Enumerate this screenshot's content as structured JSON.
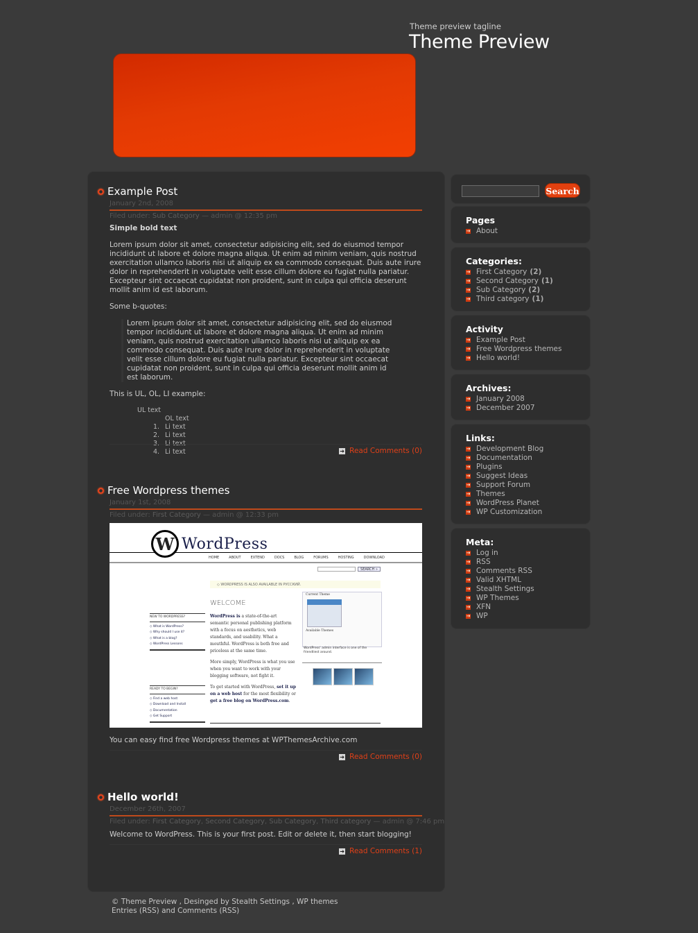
{
  "header": {
    "tagline": "Theme preview tagline",
    "title": "Theme Preview",
    "banner_color": "#e33a03"
  },
  "posts": [
    {
      "title": "Example Post",
      "date": "January 2nd, 2008",
      "filed_label": "Filed under: ",
      "categories": [
        "Sub Category"
      ],
      "meta_suffix": " — admin @ 12:35 pm",
      "bold_text": "Simple bold text",
      "paragraph": "Lorem ipsum dolor sit amet, consectetur adipisicing elit, sed do eiusmod tempor incididunt ut labore et dolore magna aliqua. Ut enim ad minim veniam, quis nostrud exercitation ullamco laboris nisi ut aliquip ex ea commodo consequat. Duis aute irure dolor in reprehenderit in voluptate velit esse cillum dolore eu fugiat nulla pariatur. Excepteur sint occaecat cupidatat non proident, sunt in culpa qui officia deserunt mollit anim id est laborum.",
      "quotes_label": "Some b-quotes:",
      "blockquote": "Lorem ipsum dolor sit amet, consectetur adipisicing elit, sed do eiusmod tempor incididunt ut labore et dolore magna aliqua. Ut enim ad minim veniam, quis nostrud exercitation ullamco laboris nisi ut aliquip ex ea commodo consequat. Duis aute irure dolor in reprehenderit in voluptate velit esse cillum dolore eu fugiat nulla pariatur. Excepteur sint occaecat cupidatat non proident, sunt in culpa qui officia deserunt mollit anim id est laborum.",
      "list_label": "This is UL, OL, LI example:",
      "ul_text": "UL text",
      "ol_text": "OL text",
      "li_items": [
        {
          "num": "1.",
          "text": "Li text"
        },
        {
          "num": "2.",
          "text": "Li text"
        },
        {
          "num": "3.",
          "text": "Li text"
        },
        {
          "num": "4.",
          "text": "Li text"
        }
      ],
      "comments_link": "Read Comments (0)"
    },
    {
      "title": "Free Wordpress themes",
      "date": "January 1st, 2008",
      "filed_label": "Filed under: ",
      "categories": [
        "First Category"
      ],
      "meta_suffix": " — admin @ 12:33 pm",
      "text_before": "You can easy find free ",
      "link_text": "Wordpress themes",
      "text_after": " at WPThemesArchive.com",
      "comments_link": "Read Comments (0)",
      "image": {
        "logo_letter": "W",
        "logo_word": "WordPress",
        "nav": [
          "HOME",
          "ABOUT",
          "EXTEND",
          "DOCS",
          "BLOG",
          "FORUMS",
          "HOSTING",
          "DOWNLOAD"
        ],
        "search_button": "SEARCH »",
        "notice": "◇ WORDPRESS IS ALSO AVAILABLE IN РУССКИЙ.",
        "welcome": "WELCOME",
        "para1_bold": "WordPress is",
        "para1": " a state-of-the-art semantic personal publishing platform with a focus on aesthetics, web standards, and usability. What a mouthful. WordPress is both free and priceless at the same time.",
        "para2": "More simply, WordPress is what you use when you want to work with your blogging software, not fight it.",
        "para3_pre": "To get started with WordPress, ",
        "para3_link1": "set it up on a web host",
        "para3_mid": " for the most flexibility or ",
        "para3_link2": "get a free blog on WordPress.com",
        "para3_end": ".",
        "side1_title": "NEW TO WORDPRESS?",
        "side1_items": [
          "◇ What is WordPress?",
          "◇ Why should I use it?",
          "◇ What is a blog?",
          "◇ WordPress Lessons"
        ],
        "side2_title": "READY TO BEGIN?",
        "side2_items": [
          "◇ Find a web host",
          "◇ Download and Install",
          "◇ Documentation",
          "◇ Get Support"
        ],
        "theme_box_title": "Current Theme",
        "theme_box_sub": "Available Themes",
        "caption": "WordPress' admin interface is one of the friendliest around."
      }
    },
    {
      "title": "Hello world!",
      "date": "December 26th, 2007",
      "filed_label": "Filed under: ",
      "categories": [
        "First Category",
        "Second Category",
        "Sub Category",
        "Third category"
      ],
      "meta_suffix": " — admin @ 7:46 pm",
      "body": "Welcome to WordPress. This is your first post. Edit or delete it, then start blogging!",
      "comments_link": "Read Comments (1)"
    }
  ],
  "sidebar": {
    "search": {
      "placeholder": "",
      "button": "Search"
    },
    "pages": {
      "title": "Pages",
      "items": [
        "About"
      ]
    },
    "categories": {
      "title": "Categories:",
      "items": [
        {
          "label": "First Category",
          "count": "(2)"
        },
        {
          "label": "Second Category",
          "count": "(1)"
        },
        {
          "label": "Sub Category",
          "count": "(2)"
        },
        {
          "label": "Third category",
          "count": "(1)"
        }
      ]
    },
    "activity": {
      "title": "Activity",
      "items": [
        "Example Post",
        "Free Wordpress themes",
        "Hello world!"
      ]
    },
    "archives": {
      "title": "Archives:",
      "items": [
        "January 2008",
        "December 2007"
      ]
    },
    "links": {
      "title": "Links:",
      "items": [
        "Development Blog",
        "Documentation",
        "Plugins",
        "Suggest Ideas",
        "Support Forum",
        "Themes",
        "WordPress Planet",
        "WP Customization"
      ]
    },
    "meta": {
      "title": "Meta:",
      "items": [
        "Log in",
        "RSS",
        "Comments RSS",
        "Valid XHTML",
        "Stealth Settings",
        "WP Themes",
        "XFN",
        "WP"
      ]
    }
  },
  "footer": {
    "copyright": "© ",
    "site_link": "Theme Preview",
    "designed_by": " , Desinged by ",
    "designer_link": "Stealth Settings",
    "sep": " , ",
    "themes_link": "WP themes",
    "entries_link": "Entries",
    "rss1": " (RSS) and ",
    "comments_link": "Comments",
    "rss2": " (RSS)"
  },
  "colors": {
    "accent": "#e2400f",
    "link": "#e04018",
    "page_bg": "#3a3a3a",
    "panel_bg": "#2e2e2e"
  }
}
